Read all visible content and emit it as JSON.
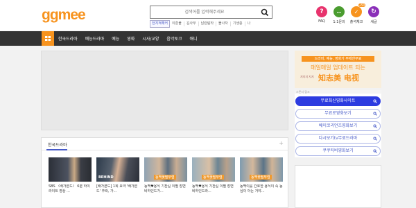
{
  "header": {
    "logo": "ggmee",
    "search_placeholder": "검색어를 입력해주세요",
    "keywords": [
      "전지적해커",
      "이혼불",
      "김사부",
      "남란탐라",
      "몰사자",
      "기생충",
      "나"
    ],
    "icons": [
      {
        "name": "faq",
        "label": "FAQ",
        "glyph": "?",
        "color": "#e8336d"
      },
      {
        "name": "inquiry",
        "label": "1:1문의",
        "glyph": "…",
        "color": "#4a9c2f"
      },
      {
        "name": "attendance",
        "label": "출석체크",
        "glyph": "✓",
        "color": "#f7931e",
        "badge": "+50"
      },
      {
        "name": "new",
        "label": "새글",
        "glyph": "↻",
        "color": "#8a2fb8"
      }
    ]
  },
  "nav": {
    "items": [
      "한국드라마",
      "예능드라마",
      "예능",
      "영화",
      "시사/교양",
      "음악토크",
      "애니"
    ]
  },
  "drama": {
    "title": "한국드라마",
    "plus": "+",
    "items": [
      {
        "caption": "SBS 〈배가본드〉 6분 하이라이트 영상 ...",
        "bg": "#3a3f4a",
        "tag": ""
      },
      {
        "caption": "[배가본드] 1회 요약 '배가본드' 추락, 가...",
        "bg": "#4a5058",
        "tag": "BEHIND"
      },
      {
        "caption": "동백♥용식 기찬길 이별 장면 비하인드가...",
        "bg": "#6e7f8c",
        "tag": "동백꽃필무렵"
      },
      {
        "caption": "동백♥용식 기찬길 이별 장면 비하인드라...",
        "bg": "#5f7a88",
        "tag": "동백꽃필무렵"
      },
      {
        "caption": "동백이를 간호한 용식이 속 동심이 아는 거야...",
        "bg": "#5b7890",
        "tag": "동백꽃필무렵"
      }
    ]
  },
  "ad": {
    "top": "드라마, 예능, 영화가 무제한무료",
    "main": "매일매일 업데이트 되는",
    "sub": "지지지 지지",
    "brand": "知志美 电视"
  },
  "side_links": {
    "label": "스폰서 링크",
    "items": [
      {
        "label": "무료최신영화사이트",
        "active": true
      },
      {
        "label": "무료로영화보기",
        "active": false
      },
      {
        "label": "베이코리언즈영화보기",
        "active": false
      },
      {
        "label": "다시보기tv무료드라마",
        "active": false
      },
      {
        "label": "쿠쿠티비영화보기",
        "active": false
      }
    ]
  }
}
